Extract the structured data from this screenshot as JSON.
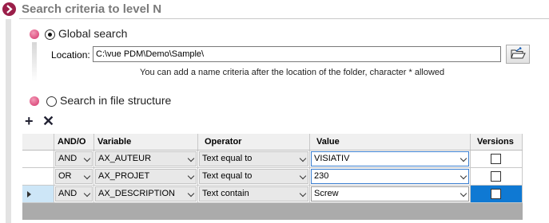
{
  "header": {
    "title": "Search criteria to level N"
  },
  "global_search": {
    "label": "Global search",
    "location_label": "Location:",
    "location_value": "C:\\vue PDM\\Demo\\Sample\\",
    "hint": "You can add a name criteria after the location of the folder, character * allowed"
  },
  "file_structure": {
    "label": "Search in file structure"
  },
  "toolbar": {
    "add_symbol": "+",
    "remove_symbol": "✕"
  },
  "grid": {
    "headers": {
      "andor": "AND/O",
      "variable": "Variable",
      "operator": "Operator",
      "value": "Value",
      "versions": "Versions"
    },
    "rows": [
      {
        "andor": "AND",
        "variable": "AX_AUTEUR",
        "operator": "Text equal to",
        "value": "VISIATIV",
        "versions": false
      },
      {
        "andor": "OR",
        "variable": "AX_PROJET",
        "operator": "Text equal to",
        "value": "230",
        "versions": false
      },
      {
        "andor": "AND",
        "variable": "AX_DESCRIPTION",
        "operator": "Text contain",
        "value": "Screw",
        "versions": false
      }
    ]
  },
  "colors": {
    "accent": "#9b1f4a",
    "bullet": "#d4326a",
    "selection": "#0f79d3"
  }
}
